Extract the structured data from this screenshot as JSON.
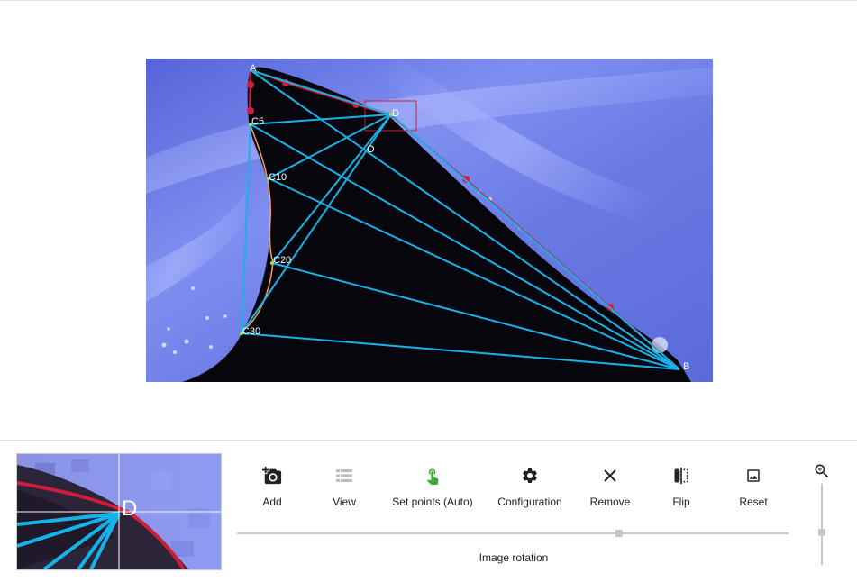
{
  "canvas": {
    "points": {
      "A": "A",
      "B": "B",
      "D": "D",
      "O": "O",
      "C5": "C5",
      "C10": "C10",
      "C20": "C20",
      "C30": "C30"
    }
  },
  "zoom_preview": {
    "label": "D"
  },
  "toolbar": {
    "items": [
      {
        "label": "Add",
        "icon": "add-photo-icon"
      },
      {
        "label": "View",
        "icon": "list-view-icon"
      },
      {
        "label": "Set points (Auto)",
        "icon": "touch-hand-icon",
        "color": "#3aaa35"
      },
      {
        "label": "Configuration",
        "icon": "gear-icon"
      },
      {
        "label": "Remove",
        "icon": "close-icon"
      },
      {
        "label": "Flip",
        "icon": "flip-icon"
      },
      {
        "label": "Reset",
        "icon": "image-icon"
      }
    ]
  },
  "rotation": {
    "label": "Image rotation",
    "value_fraction": 0.69
  },
  "zoom": {
    "icon": "zoom-in-icon",
    "value_fraction": 0.55
  },
  "colors": {
    "edge_line": "#d11c3a",
    "cyan_line": "#16b3ea",
    "contour": "#ff9b5c",
    "fin": "#08060d",
    "background_blue": "#6f7fe6"
  }
}
